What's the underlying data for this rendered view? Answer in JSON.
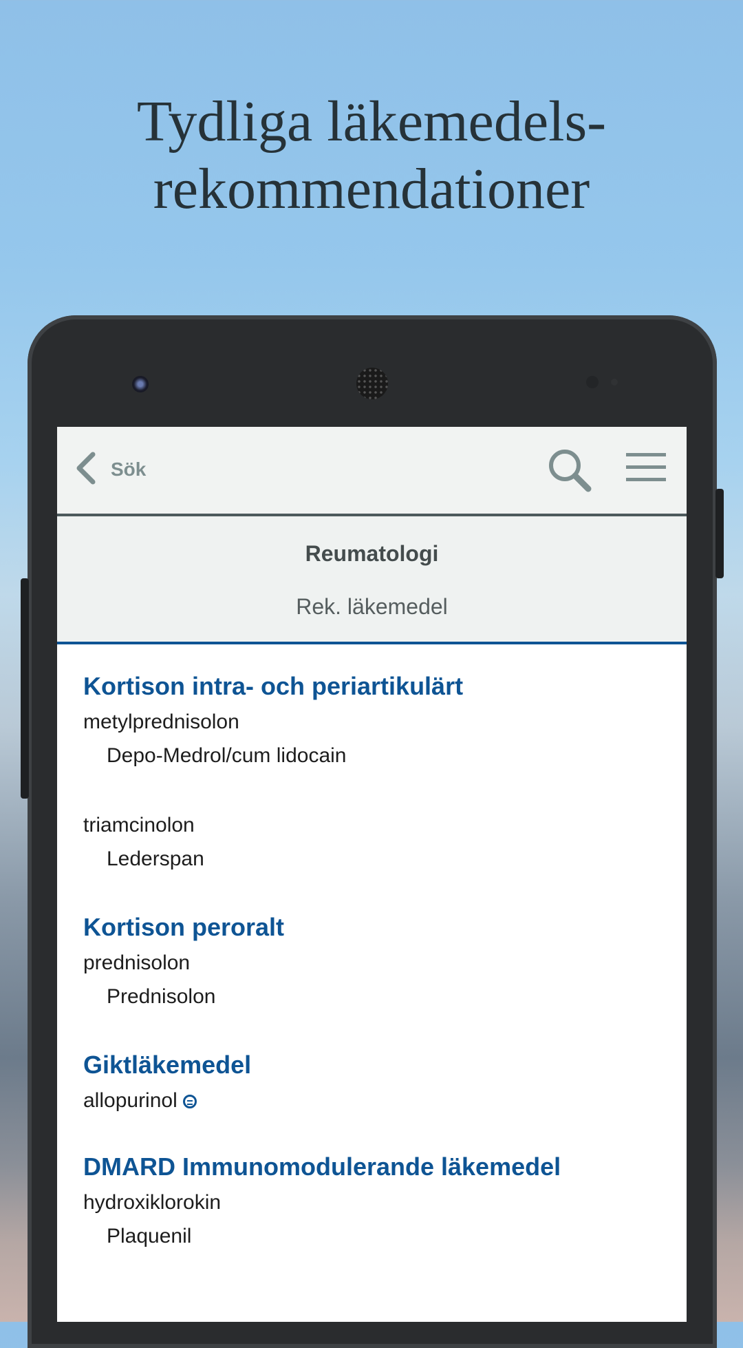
{
  "headline": {
    "line1": "Tydliga läkemedels-",
    "line2": "rekommendationer"
  },
  "appbar": {
    "back_label": "Sök",
    "icons": [
      "chevron-left-icon",
      "search-icon",
      "hamburger-menu-icon"
    ]
  },
  "subheader": {
    "section_title": "Reumatologi",
    "tab_label": "Rek. läkemedel"
  },
  "groups": [
    {
      "title": "Kortison intra- och periartikulärt",
      "substance1": "metylprednisolon",
      "product1": "Depo-Medrol/cum lidocain",
      "substance2": "triamcinolon",
      "product2": "Lederspan"
    },
    {
      "title": "Kortison peroralt",
      "substance1": "prednisolon",
      "product1": "Prednisolon"
    },
    {
      "title": "Giktläkemedel",
      "substance1": "allopurinol",
      "badge_icon": "equivalent-icon"
    },
    {
      "title": "DMARD Immunomodulerande läkemedel",
      "substance1": "hydroxiklorokin",
      "product1": "Plaquenil"
    }
  ],
  "colors": {
    "accent": "#0e5494",
    "appbar_bg": "#f1f3f2",
    "icon_gray": "#7d8e8f"
  }
}
